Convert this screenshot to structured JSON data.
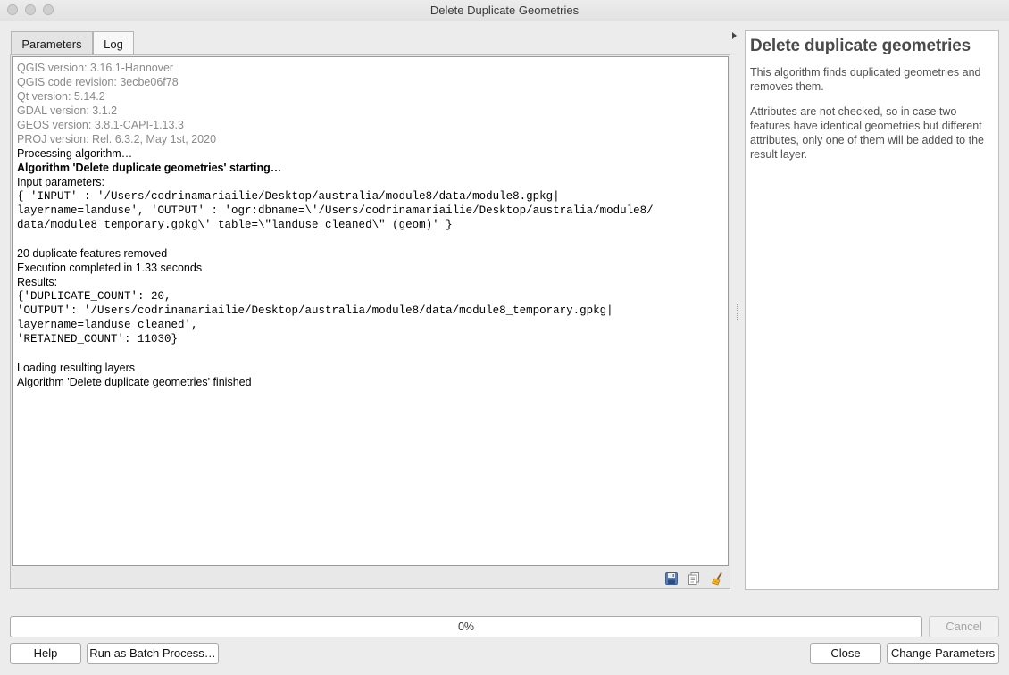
{
  "window": {
    "title": "Delete Duplicate Geometries"
  },
  "tabs": [
    {
      "label": "Parameters",
      "active": false
    },
    {
      "label": "Log",
      "active": true
    }
  ],
  "log": {
    "lines": [
      {
        "text": "QGIS version: 3.16.1-Hannover",
        "style": "gray"
      },
      {
        "text": "QGIS code revision: 3ecbe06f78",
        "style": "gray"
      },
      {
        "text": "Qt version: 5.14.2",
        "style": "gray"
      },
      {
        "text": "GDAL version: 3.1.2",
        "style": "gray"
      },
      {
        "text": "GEOS version: 3.8.1-CAPI-1.13.3",
        "style": "gray"
      },
      {
        "text": "PROJ version: Rel. 6.3.2, May 1st, 2020",
        "style": "gray"
      },
      {
        "text": "Processing algorithm…",
        "style": "normal"
      },
      {
        "text": "Algorithm 'Delete duplicate geometries' starting…",
        "style": "bold"
      },
      {
        "text": "Input parameters:",
        "style": "normal"
      },
      {
        "text": "{ 'INPUT' : '/Users/codrinamariailie/Desktop/australia/module8/data/module8.gpkg|",
        "style": "mono"
      },
      {
        "text": "layername=landuse', 'OUTPUT' : 'ogr:dbname=\\'/Users/codrinamariailie/Desktop/australia/module8/",
        "style": "mono"
      },
      {
        "text": "data/module8_temporary.gpkg\\' table=\\\"landuse_cleaned\\\" (geom)' }",
        "style": "mono"
      },
      {
        "text": "",
        "style": "normal"
      },
      {
        "text": "20 duplicate features removed",
        "style": "normal"
      },
      {
        "text": "Execution completed in 1.33 seconds",
        "style": "normal"
      },
      {
        "text": "Results:",
        "style": "normal"
      },
      {
        "text": "{'DUPLICATE_COUNT': 20,",
        "style": "mono"
      },
      {
        "text": "'OUTPUT': '/Users/codrinamariailie/Desktop/australia/module8/data/module8_temporary.gpkg|",
        "style": "mono"
      },
      {
        "text": "layername=landuse_cleaned',",
        "style": "mono"
      },
      {
        "text": "'RETAINED_COUNT': 11030}",
        "style": "mono"
      },
      {
        "text": "",
        "style": "normal"
      },
      {
        "text": "Loading resulting layers",
        "style": "normal"
      },
      {
        "text": "Algorithm 'Delete duplicate geometries' finished",
        "style": "normal"
      }
    ]
  },
  "log_toolbar": [
    {
      "name": "save-log-icon"
    },
    {
      "name": "copy-log-icon"
    },
    {
      "name": "clear-log-icon"
    }
  ],
  "help": {
    "title": "Delete duplicate geometries",
    "paragraphs": [
      "This algorithm finds duplicated geometries and removes them.",
      "Attributes are not checked, so in case two features have identical geometries but different attributes, only one of them will be added to the result layer."
    ]
  },
  "progress": {
    "value": 0,
    "label": "0%"
  },
  "buttons": {
    "cancel": "Cancel",
    "help": "Help",
    "batch": "Run as Batch Process…",
    "close": "Close",
    "change": "Change Parameters"
  }
}
